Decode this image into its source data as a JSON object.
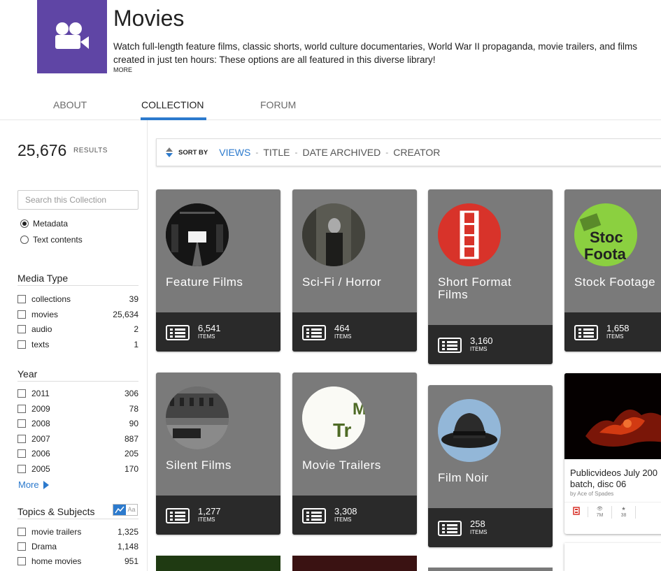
{
  "header": {
    "title": "Movies",
    "description_line1": "Watch full-length feature films, classic shorts, world culture documentaries, World War II propaganda, movie trailers, and films",
    "description_line2": "created in just ten hours: These options are all featured in this diverse library!",
    "more": "MORE",
    "logo_icon": "film-camera-icon",
    "logo_color": "#5f45a5"
  },
  "tabs": [
    {
      "label": "ABOUT",
      "active": false
    },
    {
      "label": "COLLECTION",
      "active": true
    },
    {
      "label": "FORUM",
      "active": false
    }
  ],
  "results": {
    "count": "25,676",
    "label": "RESULTS"
  },
  "search": {
    "placeholder": "Search this Collection"
  },
  "search_options": [
    {
      "label": "Metadata",
      "selected": true
    },
    {
      "label": "Text contents",
      "selected": false
    }
  ],
  "facets": {
    "media_type": {
      "title": "Media Type",
      "items": [
        {
          "label": "collections",
          "count": "39"
        },
        {
          "label": "movies",
          "count": "25,634"
        },
        {
          "label": "audio",
          "count": "2"
        },
        {
          "label": "texts",
          "count": "1"
        }
      ]
    },
    "year": {
      "title": "Year",
      "items": [
        {
          "label": "2011",
          "count": "306"
        },
        {
          "label": "2009",
          "count": "78"
        },
        {
          "label": "2008",
          "count": "90"
        },
        {
          "label": "2007",
          "count": "887"
        },
        {
          "label": "2006",
          "count": "205"
        },
        {
          "label": "2005",
          "count": "170"
        }
      ],
      "more": "More"
    },
    "topics": {
      "title": "Topics & Subjects",
      "toggle_text": "Aa",
      "items": [
        {
          "label": "movie trailers",
          "count": "1,325"
        },
        {
          "label": "Drama",
          "count": "1,148"
        },
        {
          "label": "home movies",
          "count": "951"
        }
      ]
    }
  },
  "sort": {
    "label": "SORT BY",
    "options": [
      {
        "label": "VIEWS",
        "active": true
      },
      {
        "label": "TITLE",
        "active": false
      },
      {
        "label": "DATE ARCHIVED",
        "active": false
      },
      {
        "label": "CREATOR",
        "active": false
      }
    ],
    "separator": "-"
  },
  "tiles": [
    {
      "name": "Feature Films",
      "count": "6,541",
      "items_label": "ITEMS"
    },
    {
      "name": "Sci-Fi / Horror",
      "count": "464",
      "items_label": "ITEMS"
    },
    {
      "name_line1": "Short Format",
      "name_line2": "Films",
      "count": "3,160",
      "items_label": "ITEMS"
    },
    {
      "name": "Stock Footage",
      "count": "1,658",
      "items_label": "ITEMS",
      "thumb_text1": "Stoc",
      "thumb_text2": "Foota"
    },
    {
      "name": "Silent Films",
      "count": "1,277",
      "items_label": "ITEMS"
    },
    {
      "name": "Movie Trailers",
      "count": "3,308",
      "items_label": "ITEMS",
      "thumb_text1": "M",
      "thumb_text2": "Tr"
    },
    {
      "name": "Film Noir",
      "count": "258",
      "items_label": "ITEMS"
    }
  ],
  "item_card": {
    "title_line1": "Publicvideos July 200",
    "title_line2": "batch, disc 06",
    "by": "by Ace of Spades",
    "views": "7M",
    "favorites": "38"
  }
}
